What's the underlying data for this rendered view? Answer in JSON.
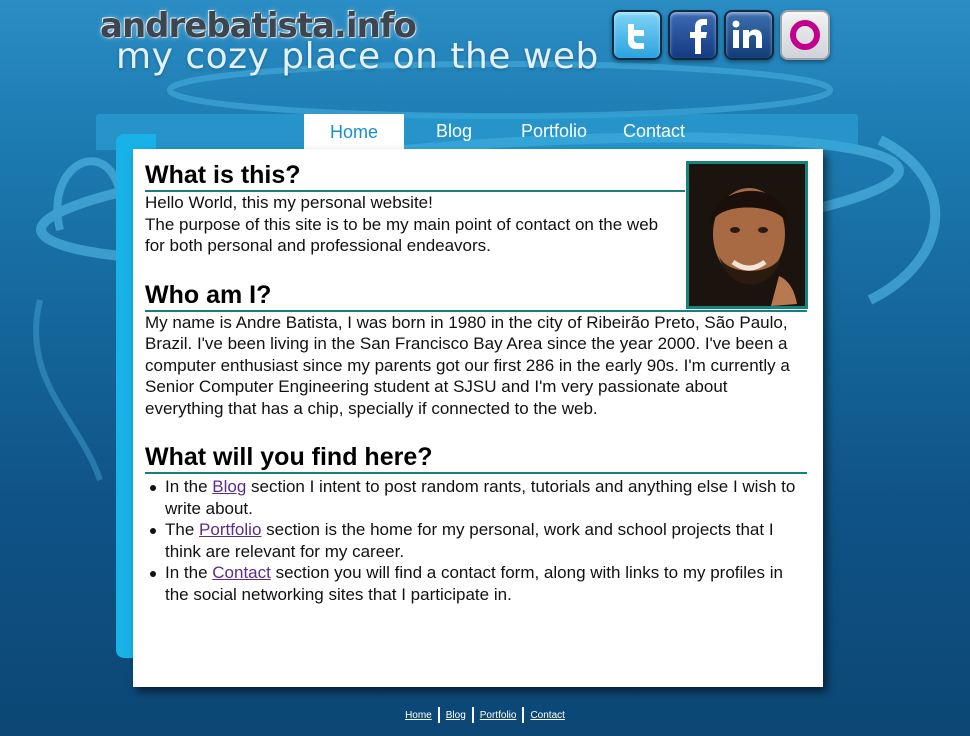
{
  "header": {
    "brand": "andrebatista.info",
    "tagline": "my cozy place on the web"
  },
  "social": [
    {
      "name": "twitter",
      "icon": "twitter-icon"
    },
    {
      "name": "facebook",
      "icon": "facebook-icon"
    },
    {
      "name": "linkedin",
      "icon": "linkedin-icon"
    },
    {
      "name": "orkut",
      "icon": "orkut-icon"
    }
  ],
  "nav": {
    "items": [
      {
        "label": "Home",
        "active": true
      },
      {
        "label": "Blog",
        "active": false
      },
      {
        "label": "Portfolio",
        "active": false
      },
      {
        "label": "Contact",
        "active": false
      }
    ]
  },
  "sections": {
    "what": {
      "title": "What is this?",
      "lines": [
        "Hello World, this my personal website!",
        "The purpose of this site is to be my main point of contact on the web for both personal and professional endeavors."
      ]
    },
    "who": {
      "title": "Who am I?",
      "text": "My name is Andre Batista, I was born in 1980 in the city of Ribeirão Preto, São Paulo, Brazil. I've been living in the San Francisco Bay Area since the year 2000. I've been a computer enthusiast since my parents got our first 286 in the early 90s. I'm currently a Senior Computer Engineering student at SJSU and I'm very passionate about everything that has a chip, specially if connected to the web."
    },
    "find": {
      "title": "What will you find here?",
      "items": [
        {
          "before": "In the ",
          "link": "Blog",
          "after": " section I intent to post random rants, tutorials and anything else I wish to write about."
        },
        {
          "before": "The ",
          "link": "Portfolio",
          "after": " section is the home for my personal, work and school projects that I think are relevant for my career."
        },
        {
          "before": "In the ",
          "link": "Contact",
          "after": " section you will find a contact form, along with links to my profiles in the social networking sites that I participate in."
        }
      ]
    }
  },
  "footer": {
    "links": [
      "Home",
      "Blog",
      "Portfolio",
      "Contact"
    ]
  },
  "colors": {
    "accent": "#17807d",
    "nav_active_text": "#1a8fc9",
    "link": "#5b2c8d"
  }
}
